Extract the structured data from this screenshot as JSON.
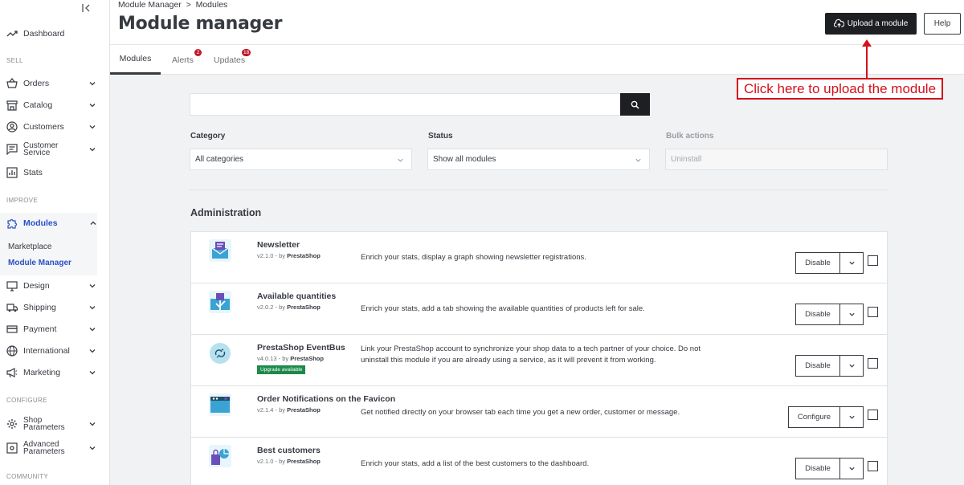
{
  "sidebar": {
    "dashboard": "Dashboard",
    "sections": {
      "sell": "SELL",
      "improve": "IMPROVE",
      "configure": "CONFIGURE",
      "community": "COMMUNITY"
    },
    "sell_items": [
      "Orders",
      "Catalog",
      "Customers",
      "Customer Service",
      "Stats"
    ],
    "customer_service_line1": "Customer",
    "customer_service_line2": "Service",
    "modules": "Modules",
    "modules_sub": [
      "Marketplace",
      "Module Manager"
    ],
    "improve_items": [
      "Design",
      "Shipping",
      "Payment",
      "International",
      "Marketing"
    ],
    "shop_parameters_line1": "Shop",
    "shop_parameters_line2": "Parameters",
    "advanced_parameters_line1": "Advanced",
    "advanced_parameters_line2": "Parameters"
  },
  "header": {
    "breadcrumb": "Module Manager  >  Modules",
    "title": "Module manager",
    "upload_label": "Upload a module",
    "help_label": "Help"
  },
  "tabs": [
    {
      "label": "Modules",
      "badge": ""
    },
    {
      "label": "Alerts",
      "badge": "2"
    },
    {
      "label": "Updates",
      "badge": "18"
    }
  ],
  "annotation": "Click here to upload the module",
  "search": {
    "value": "",
    "placeholder": ""
  },
  "filters": {
    "category_label": "Category",
    "category_value": "All categories",
    "status_label": "Status",
    "status_value": "Show all modules",
    "bulk_label": "Bulk actions",
    "bulk_value": "Uninstall"
  },
  "section_heading": "Administration",
  "modules": [
    {
      "name": "Newsletter",
      "version": "v2.1.0 - by ",
      "author": "PrestaShop",
      "desc": "Enrich your stats, display a graph showing newsletter registrations.",
      "action": "Disable",
      "upgrade": ""
    },
    {
      "name": "Available quantities",
      "version": "v2.0.2 - by ",
      "author": "PrestaShop",
      "desc": "Enrich your stats, add a tab showing the available quantities of products left for sale.",
      "action": "Disable",
      "upgrade": ""
    },
    {
      "name": "PrestaShop EventBus",
      "version": "v4.0.13 - by ",
      "author": "PrestaShop",
      "desc": "Link your PrestaShop account to synchronize your shop data to a tech partner of your choice. Do not uninstall this module if you are already using a service, as it will prevent it from working.",
      "action": "Disable",
      "upgrade": "Upgrade available"
    },
    {
      "name": "Order Notifications on the Favicon",
      "version": "v2.1.4 - by ",
      "author": "PrestaShop",
      "desc": "Get notified directly on your browser tab each time you get a new order, customer or message.",
      "action": "Configure",
      "upgrade": ""
    },
    {
      "name": "Best customers",
      "version": "v2.1.0 - by ",
      "author": "PrestaShop",
      "desc": "Enrich your stats, add a list of the best customers to the dashboard.",
      "action": "Disable",
      "upgrade": ""
    }
  ],
  "colors": {
    "accent_red": "#d3111c",
    "active_blue": "#2a4fc4",
    "dark_button": "#1d1f22",
    "upgrade_green": "#1d8a4a",
    "badge_red": "#c11828"
  }
}
